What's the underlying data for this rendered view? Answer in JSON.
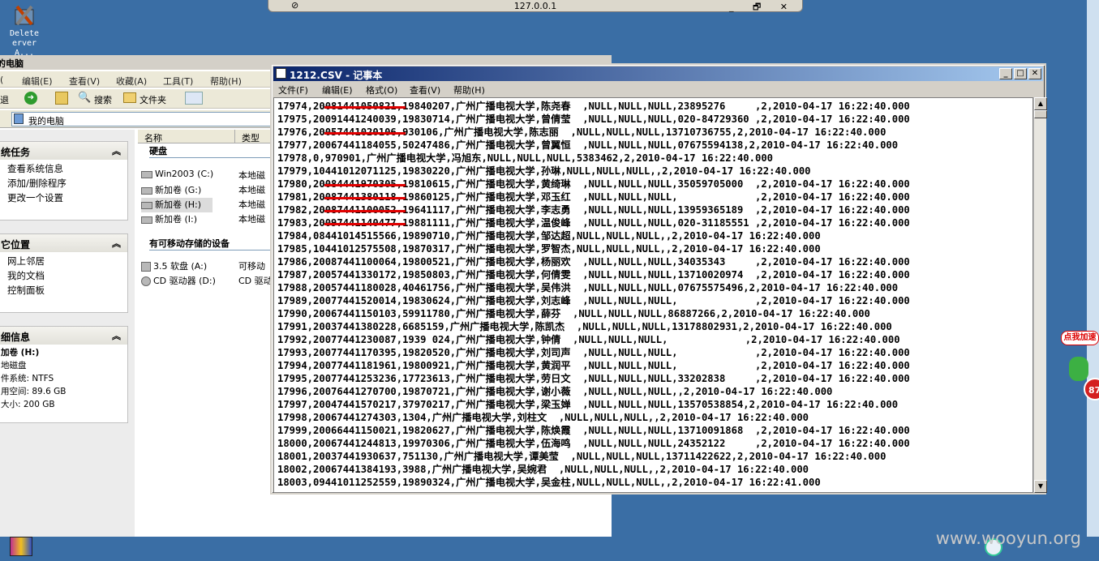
{
  "desktop_icon": {
    "label_line1": "Delete",
    "label_line2": "erver A..."
  },
  "remote_bar": {
    "title": "127.0.0.1",
    "controls": "_ 🗗 ✕"
  },
  "explorer": {
    "title": "的电脑",
    "menu": [
      "编辑(E)",
      "查看(V)",
      "收藏(A)",
      "工具(T)",
      "帮助(H)"
    ],
    "menu_first": "(",
    "toolbar": {
      "back_label": "退",
      "search": "搜索",
      "folders": "文件夹"
    },
    "address": "我的电脑",
    "tasks": {
      "system_title": "统任务",
      "system_items": [
        "查看系统信息",
        "添加/删除程序",
        "更改一个设置"
      ],
      "other_title": "它位置",
      "other_items": [
        "网上邻居",
        "我的文档",
        "控制面板"
      ],
      "detail_title": "细信息",
      "detail_lines": [
        "加卷 (H:)",
        "地磁盘",
        "件系统: NTFS",
        "用空间: 89.6 GB",
        "大小: 200 GB"
      ]
    },
    "columns": {
      "name": "名称",
      "type": "类型"
    },
    "hdd_group": "硬盘",
    "drives": [
      {
        "name": "Win2003 (C:)",
        "type": "本地磁"
      },
      {
        "name": "新加卷 (G:)",
        "type": "本地磁"
      },
      {
        "name": "新加卷 (H:)",
        "type": "本地磁"
      },
      {
        "name": "新加卷 (I:)",
        "type": "本地磁"
      }
    ],
    "removable_group": "有可移动存储的设备",
    "removables": [
      {
        "name": "3.5 软盘 (A:)",
        "type": "可移动"
      },
      {
        "name": "CD 驱动器 (D:)",
        "type": "CD 驱动"
      }
    ]
  },
  "notepad": {
    "title": "1212.CSV - 记事本",
    "menu": [
      "文件(F)",
      "编辑(E)",
      "格式(O)",
      "查看(V)",
      "帮助(H)"
    ],
    "lines": [
      "17974,20081441050821,19840207,广州广播电视大学,陈尧春  ,NULL,NULL,NULL,23895276     ,2,2010-04-17 16:22:40.000",
      "17975,20091441240039,19830714,广州广播电视大学,曾倩莹  ,NULL,NULL,NULL,020-84729360 ,2,2010-04-17 16:22:40.000",
      "17976,20057441020106,930106,广州广播电视大学,陈志丽  ,NULL,NULL,NULL,13710736755,2,2010-04-17 16:22:40.000",
      "17977,20067441184055,50247486,广州广播电视大学,曾翼恒  ,NULL,NULL,NULL,07675594138,2,2010-04-17 16:22:40.000",
      "17978,0,970901,广州广播电视大学,冯旭东,NULL,NULL,NULL,5383462,2,2010-04-17 16:22:40.000",
      "17979,10441012071125,19830220,广州广播电视大学,孙琳,NULL,NULL,NULL,,2,2010-04-17 16:22:40.000",
      "17980,20084441970305,19810615,广州广播电视大学,黄绮琳  ,NULL,NULL,NULL,35059705000  ,2,2010-04-17 16:22:40.000",
      "17981,20087441380118,19860125,广州广播电视大学,邓玉红  ,NULL,NULL,NULL,             ,2,2010-04-17 16:22:40.000",
      "17982,20087441100052,19641117,广州广播电视大学,李志勇  ,NULL,NULL,NULL,13959365189  ,2,2010-04-17 16:22:40.000",
      "17983,20097441140477,19881111,广州广播电视大学,温俊峰  ,NULL,NULL,NULL,020-31185551 ,2,2010-04-17 16:22:40.000",
      "17984,08441014515566,19890710,广州广播电视大学,邹达超,NULL,NULL,NULL,,2,2010-04-17 16:22:40.000",
      "17985,10441012575508,19870317,广州广播电视大学,罗智杰,NULL,NULL,NULL,,2,2010-04-17 16:22:40.000",
      "17986,20087441100064,19800521,广州广播电视大学,杨丽欢  ,NULL,NULL,NULL,34035343     ,2,2010-04-17 16:22:40.000",
      "17987,20057441330172,19850803,广州广播电视大学,何倩雯  ,NULL,NULL,NULL,13710020974  ,2,2010-04-17 16:22:40.000",
      "17988,20057441180028,40461756,广州广播电视大学,吴伟洪  ,NULL,NULL,NULL,07675575496,2,2010-04-17 16:22:40.000",
      "17989,20077441520014,19830624,广州广播电视大学,刘志峰  ,NULL,NULL,NULL,             ,2,2010-04-17 16:22:40.000",
      "17990,20067441150103,59911780,广州广播电视大学,薛芬  ,NULL,NULL,NULL,86887266,2,2010-04-17 16:22:40.000",
      "17991,20037441380228,6685159,广州广播电视大学,陈凯杰  ,NULL,NULL,NULL,13178802931,2,2010-04-17 16:22:40.000",
      "17992,20077441230087,1939 024,广州广播电视大学,钟倩  ,NULL,NULL,NULL,             ,2,2010-04-17 16:22:40.000",
      "17993,20077441170395,19820520,广州广播电视大学,刘司声  ,NULL,NULL,NULL,             ,2,2010-04-17 16:22:40.000",
      "17994,20077441181961,19800921,广州广播电视大学,黄润平  ,NULL,NULL,NULL,             ,2,2010-04-17 16:22:40.000",
      "17995,20077441253236,17723613,广州广播电视大学,劳日文  ,NULL,NULL,NULL,33202838     ,2,2010-04-17 16:22:40.000",
      "17996,20076441270700,19870721,广州广播电视大学,谢小薇  ,NULL,NULL,NULL,,2,2010-04-17 16:22:40.000",
      "17997,20047441570217,37970217,广州广播电视大学,梁玉婵  ,NULL,NULL,NULL,13570538854,2,2010-04-17 16:22:40.000",
      "17998,20067441274303,1304,广州广播电视大学,刘柱文  ,NULL,NULL,NULL,,2,2010-04-17 16:22:40.000",
      "17999,20066441150021,19820627,广州广播电视大学,陈焕霞  ,NULL,NULL,NULL,13710091868  ,2,2010-04-17 16:22:40.000",
      "18000,20067441244813,19970306,广州广播电视大学,伍海鸣  ,NULL,NULL,NULL,24352122     ,2,2010-04-17 16:22:40.000",
      "18001,20037441930637,751130,广州广播电视大学,谭美莹  ,NULL,NULL,NULL,13711422622,2,2010-04-17 16:22:40.000",
      "18002,20067441384193,3988,广州广播电视大学,吴婉君  ,NULL,NULL,NULL,,2,2010-04-17 16:22:40.000",
      "18003,09441011252559,19890324,广州广播电视大学,吴金柱,NULL,NULL,NULL,,2,2010-04-17 16:22:41.000"
    ]
  },
  "side_ad": {
    "label": "点我加速",
    "count": "87"
  },
  "watermark": "www.wooyun.org"
}
